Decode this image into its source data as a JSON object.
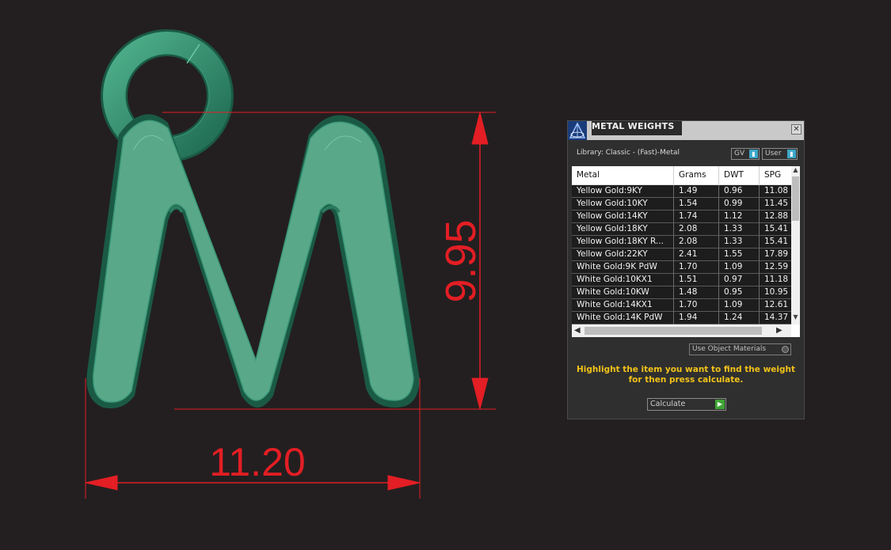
{
  "dimensions": {
    "height_label": "9.95",
    "width_label": "11.20"
  },
  "colors": {
    "background": "#231f20",
    "model_green": "#3f9a78",
    "dimension_red": "#e31e24",
    "panel_bg": "#2f2f2f",
    "instruction_yellow": "#f2c21a",
    "calculate_green": "#3fa535"
  },
  "panel": {
    "title": "METAL WEIGHTS",
    "close_icon": "close-icon",
    "library_label": "Library: Classic - (Fast)-Metal",
    "gv_select": "GV",
    "user_select": "User",
    "table": {
      "columns": [
        "Metal",
        "Grams",
        "DWT",
        "SPG"
      ],
      "rows": [
        [
          "Yellow Gold:9KY",
          "1.49",
          "0.96",
          "11.08"
        ],
        [
          "Yellow Gold:10KY",
          "1.54",
          "0.99",
          "11.45"
        ],
        [
          "Yellow Gold:14KY",
          "1.74",
          "1.12",
          "12.88"
        ],
        [
          "Yellow Gold:18KY",
          "2.08",
          "1.33",
          "15.41"
        ],
        [
          "Yellow Gold:18KY R...",
          "2.08",
          "1.33",
          "15.41"
        ],
        [
          "Yellow Gold:22KY",
          "2.41",
          "1.55",
          "17.89"
        ],
        [
          "White Gold:9K PdW",
          "1.70",
          "1.09",
          "12.59"
        ],
        [
          "White Gold:10KX1",
          "1.51",
          "0.97",
          "11.18"
        ],
        [
          "White Gold:10KW",
          "1.48",
          "0.95",
          "10.95"
        ],
        [
          "White Gold:14KX1",
          "1.70",
          "1.09",
          "12.61"
        ],
        [
          "White Gold:14K PdW",
          "1.94",
          "1.24",
          "14.37"
        ]
      ]
    },
    "use_object_materials": "Use Object Materials",
    "instructions_line1": "Highlight the item you want to find the weight",
    "instructions_line2": "for then press calculate.",
    "calculate_label": "Calculate"
  }
}
